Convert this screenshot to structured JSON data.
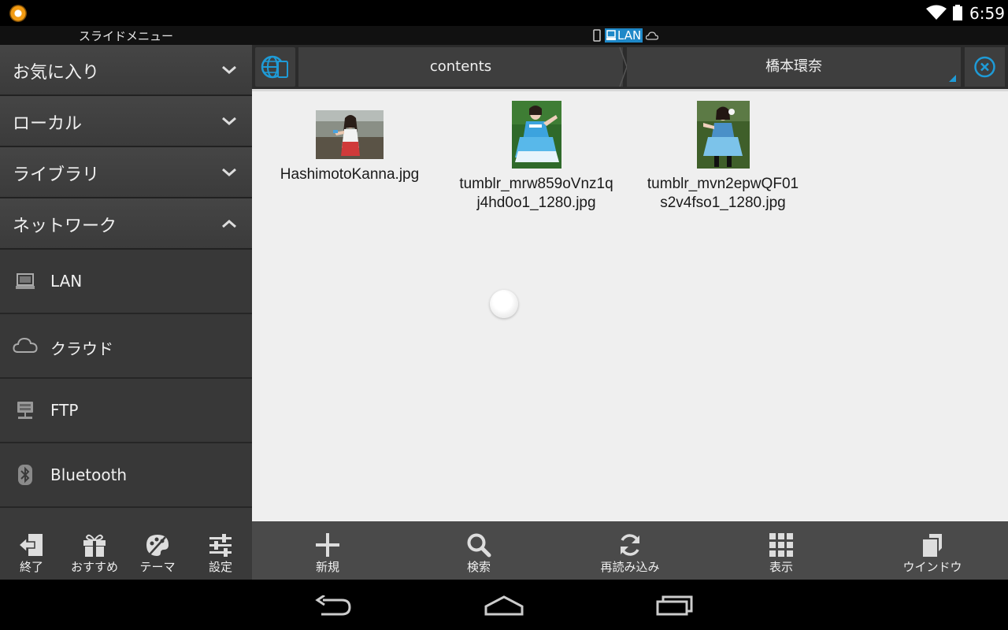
{
  "status_bar": {
    "time": "6:59",
    "app_icon": "app-orange-icon",
    "wifi_icon": "wifi-icon",
    "battery_icon": "battery-icon"
  },
  "header": {
    "slide_menu_title": "スライドメニュー",
    "connection_label": "LAN"
  },
  "sidebar": {
    "categories": [
      {
        "label": "お気に入り",
        "expanded": false
      },
      {
        "label": "ローカル",
        "expanded": false
      },
      {
        "label": "ライブラリ",
        "expanded": false
      },
      {
        "label": "ネットワーク",
        "expanded": true
      }
    ],
    "network_items": [
      {
        "label": "LAN",
        "icon": "laptop-icon"
      },
      {
        "label": "クラウド",
        "icon": "cloud-icon"
      },
      {
        "label": "FTP",
        "icon": "ftp-server-icon"
      },
      {
        "label": "Bluetooth",
        "icon": "bluetooth-icon"
      }
    ]
  },
  "breadcrumb": {
    "items": [
      "contents",
      "橋本環奈"
    ]
  },
  "files": [
    {
      "name": "HashimotoKanna.jpg",
      "icon": "image-thumbnail"
    },
    {
      "name": "tumblr_mrw859oVnz1q\nj4hd0o1_1280.jpg",
      "icon": "image-thumbnail"
    },
    {
      "name": "tumblr_mvn2epwQF01\ns2v4fso1_1280.jpg",
      "icon": "image-thumbnail"
    }
  ],
  "toolbar_left": [
    {
      "label": "終了",
      "icon": "exit-icon"
    },
    {
      "label": "おすすめ",
      "icon": "gift-icon"
    },
    {
      "label": "テーマ",
      "icon": "palette-icon"
    },
    {
      "label": "設定",
      "icon": "settings-sliders-icon"
    }
  ],
  "toolbar_right": [
    {
      "label": "新規",
      "icon": "plus-icon"
    },
    {
      "label": "検索",
      "icon": "search-icon"
    },
    {
      "label": "再読み込み",
      "icon": "refresh-icon"
    },
    {
      "label": "表示",
      "icon": "grid-icon"
    },
    {
      "label": "ウインドウ",
      "icon": "windows-icon"
    }
  ],
  "colors": {
    "accent": "#1e9bd7",
    "lan_tag": "#1e88c8",
    "content_bg": "#efefef",
    "sidebar_bg": "#3a3a3a"
  }
}
